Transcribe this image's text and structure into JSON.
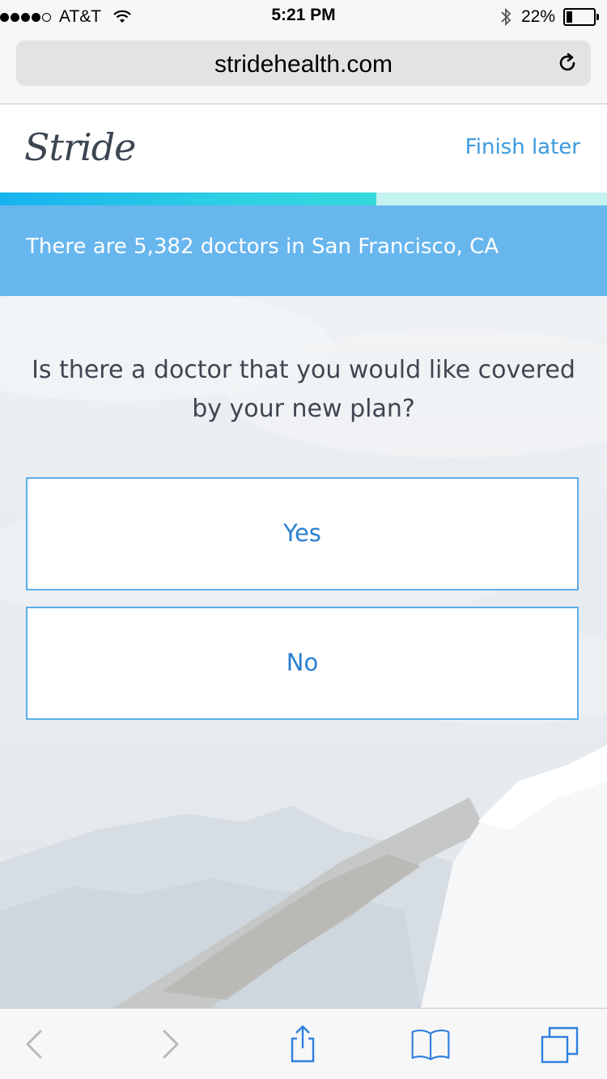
{
  "status_bar": {
    "carrier": "AT&T",
    "time": "5:21 PM",
    "battery_percent": "22%",
    "battery_level": 0.22,
    "signal_bars_filled": 4,
    "signal_bars_total": 5
  },
  "browser": {
    "url": "stridehealth.com",
    "icons": {
      "reload": "reload-icon",
      "back": "chevron-left-icon",
      "forward": "chevron-right-icon",
      "share": "share-icon",
      "bookmarks": "book-icon",
      "tabs": "tabs-icon"
    }
  },
  "header": {
    "logo": "Stride",
    "finish_later": "Finish later"
  },
  "progress": {
    "value": 0.62,
    "colors": {
      "fill_start": "#16b3ef",
      "fill_end": "#35d8dc",
      "track": "#c4f2ee"
    }
  },
  "banner": {
    "text": "There are 5,382 doctors in San Francisco, CA",
    "color": "#68b6ee"
  },
  "question": {
    "text": "Is there a doctor that you would like covered by your new plan?"
  },
  "choices": {
    "yes": "Yes",
    "no": "No"
  },
  "colors": {
    "accent": "#3b9be0",
    "choice_border": "#5aaee8",
    "choice_text": "#2a7fd0",
    "text_dark": "#3e4651"
  }
}
